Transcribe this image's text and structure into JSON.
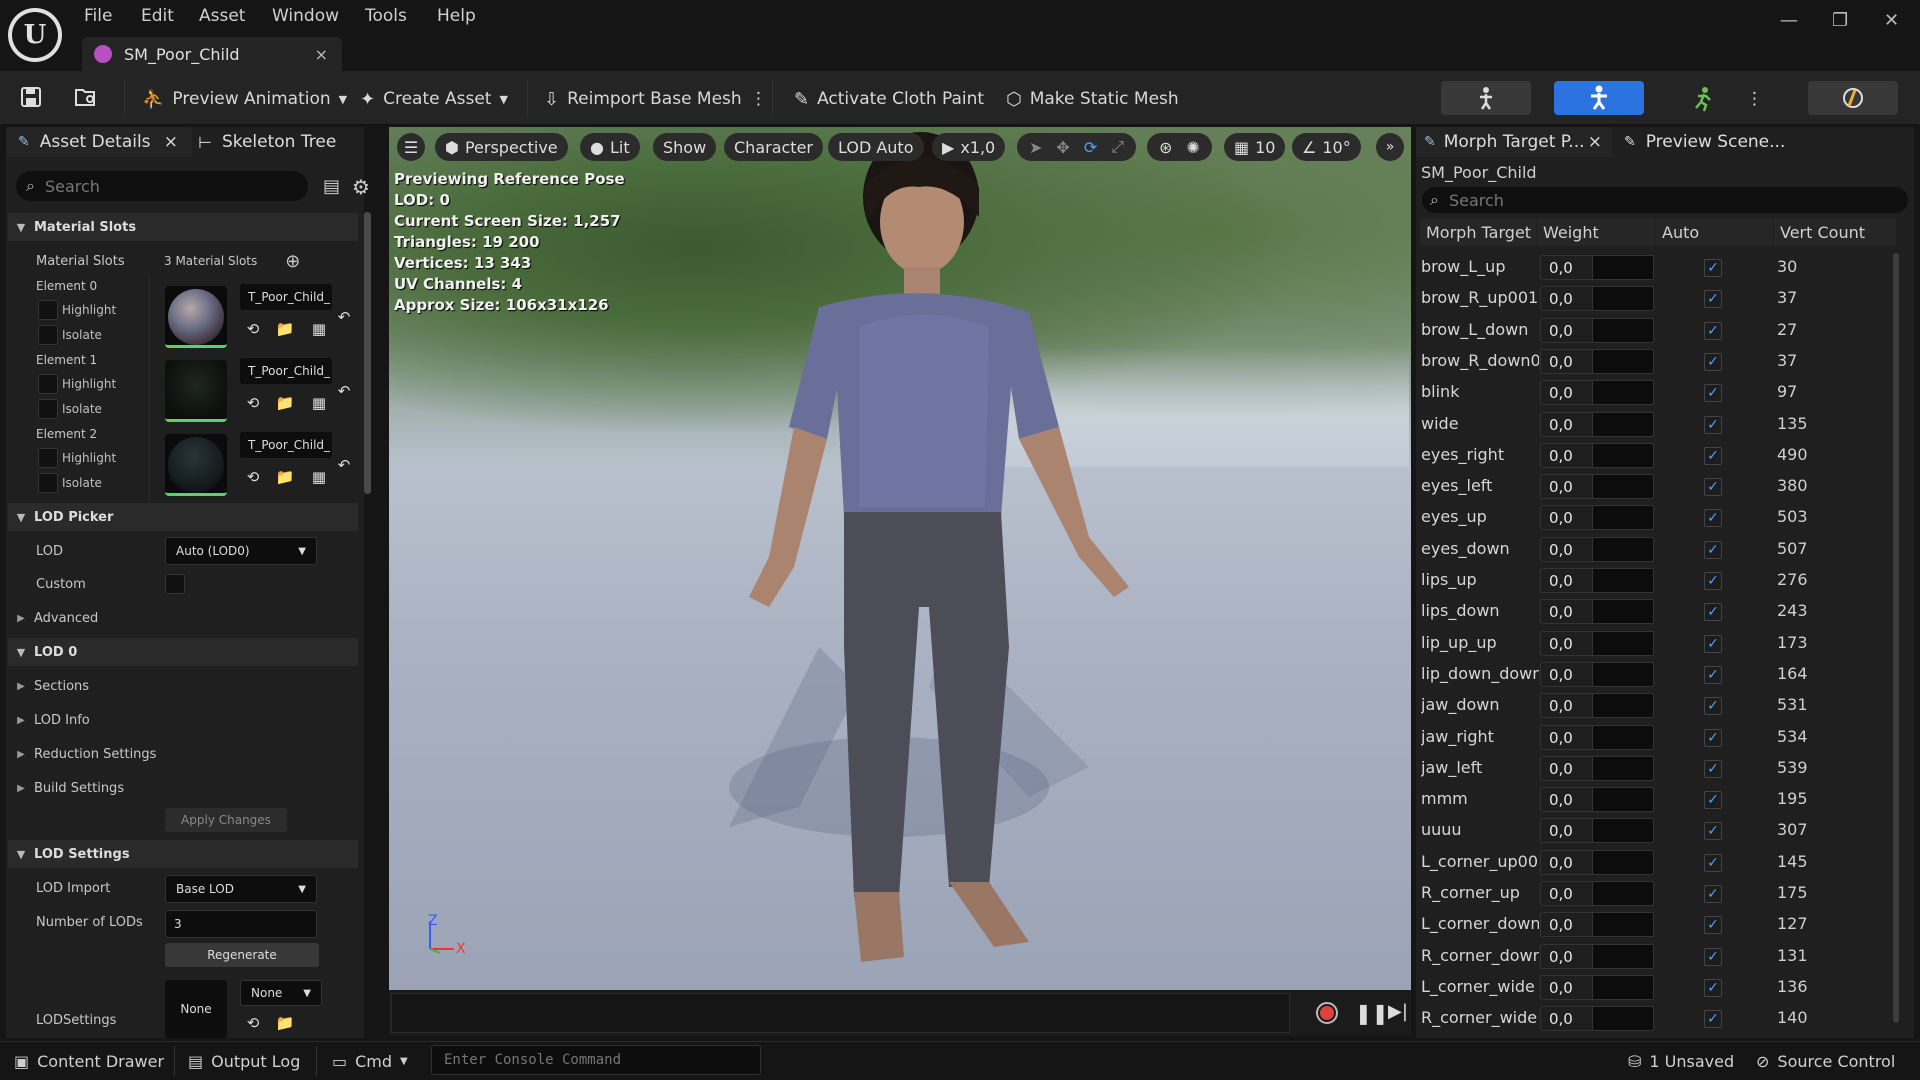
{
  "menu": [
    "File",
    "Edit",
    "Asset",
    "Window",
    "Tools",
    "Help"
  ],
  "doc_tab": {
    "title": "SM_Poor_Child",
    "close": "×"
  },
  "window_controls": {
    "minimize": "—",
    "restore": "❐",
    "close": "✕"
  },
  "toolbar": {
    "preview_animation": "Preview Animation",
    "create_asset": "Create Asset",
    "reimport": "Reimport Base Mesh",
    "activate_cloth_paint": "Activate Cloth Paint",
    "make_static_mesh": "Make Static Mesh"
  },
  "left_panel": {
    "tab_details": "Asset Details",
    "tab_close": "×",
    "tab_skeleton": "Skeleton Tree",
    "search_placeholder": "Search",
    "material_slots": {
      "header": "Material Slots",
      "label": "Material Slots",
      "value": "3 Material Slots",
      "elements": [
        {
          "name": "Element 0",
          "texture": "T_Poor_Child_",
          "highlight": "Highlight",
          "isolate": "Isolate"
        },
        {
          "name": "Element 1",
          "texture": "T_Poor_Child_",
          "highlight": "Highlight",
          "isolate": "Isolate"
        },
        {
          "name": "Element 2",
          "texture": "T_Poor_Child_",
          "highlight": "Highlight",
          "isolate": "Isolate"
        }
      ]
    },
    "lod_picker": {
      "header": "LOD Picker",
      "lod_label": "LOD",
      "lod_value": "Auto (LOD0)",
      "custom_label": "Custom",
      "advanced": "Advanced"
    },
    "lod0": {
      "header": "LOD 0",
      "sections": "Sections",
      "lod_info": "LOD Info",
      "reduction": "Reduction Settings",
      "build": "Build Settings",
      "apply": "Apply Changes"
    },
    "lod_settings": {
      "header": "LOD Settings",
      "import_label": "LOD Import",
      "import_value": "Base LOD",
      "num_label": "Number of LODs",
      "num_value": "3",
      "regenerate": "Regenerate",
      "settings_label": "LODSettings",
      "settings_thumb": "None",
      "settings_value": "None"
    }
  },
  "viewport": {
    "buttons": {
      "perspective": "Perspective",
      "lit": "Lit",
      "show": "Show",
      "character": "Character",
      "lod": "LOD Auto",
      "speed": "x1,0",
      "grid": "10",
      "angle": "10°"
    },
    "overlay": [
      "Previewing Reference Pose",
      "LOD: 0",
      "Current Screen Size: 1,257",
      "Triangles: 19 200",
      "Vertices: 13 343",
      "UV Channels: 4",
      "Approx Size: 106x31x126"
    ],
    "axis": {
      "z": "Z",
      "x": "X"
    }
  },
  "right_panel": {
    "tab_morph": "Morph Target P...",
    "tab_close": "×",
    "tab_scene": "Preview Scene...",
    "asset": "SM_Poor_Child",
    "search_placeholder": "Search",
    "columns": [
      "Morph Target",
      "Weight",
      "Auto",
      "Vert Count"
    ],
    "rows": [
      {
        "name": "brow_L_up",
        "weight": "0,0",
        "auto": "✓",
        "verts": "30"
      },
      {
        "name": "brow_R_up001",
        "weight": "0,0",
        "auto": "✓",
        "verts": "37"
      },
      {
        "name": "brow_L_down",
        "weight": "0,0",
        "auto": "✓",
        "verts": "27"
      },
      {
        "name": "brow_R_down0",
        "weight": "0,0",
        "auto": "✓",
        "verts": "37"
      },
      {
        "name": "blink",
        "weight": "0,0",
        "auto": "✓",
        "verts": "97"
      },
      {
        "name": "wide",
        "weight": "0,0",
        "auto": "✓",
        "verts": "135"
      },
      {
        "name": "eyes_right",
        "weight": "0,0",
        "auto": "✓",
        "verts": "490"
      },
      {
        "name": "eyes_left",
        "weight": "0,0",
        "auto": "✓",
        "verts": "380"
      },
      {
        "name": "eyes_up",
        "weight": "0,0",
        "auto": "✓",
        "verts": "503"
      },
      {
        "name": "eyes_down",
        "weight": "0,0",
        "auto": "✓",
        "verts": "507"
      },
      {
        "name": "lips_up",
        "weight": "0,0",
        "auto": "✓",
        "verts": "276"
      },
      {
        "name": "lips_down",
        "weight": "0,0",
        "auto": "✓",
        "verts": "243"
      },
      {
        "name": "lip_up_up",
        "weight": "0,0",
        "auto": "✓",
        "verts": "173"
      },
      {
        "name": "lip_down_down",
        "weight": "0,0",
        "auto": "✓",
        "verts": "164"
      },
      {
        "name": "jaw_down",
        "weight": "0,0",
        "auto": "✓",
        "verts": "531"
      },
      {
        "name": "jaw_right",
        "weight": "0,0",
        "auto": "✓",
        "verts": "534"
      },
      {
        "name": "jaw_left",
        "weight": "0,0",
        "auto": "✓",
        "verts": "539"
      },
      {
        "name": "mmm",
        "weight": "0,0",
        "auto": "✓",
        "verts": "195"
      },
      {
        "name": "uuuu",
        "weight": "0,0",
        "auto": "✓",
        "verts": "307"
      },
      {
        "name": "L_corner_up00",
        "weight": "0,0",
        "auto": "✓",
        "verts": "145"
      },
      {
        "name": "R_corner_up",
        "weight": "0,0",
        "auto": "✓",
        "verts": "175"
      },
      {
        "name": "L_corner_down",
        "weight": "0,0",
        "auto": "✓",
        "verts": "127"
      },
      {
        "name": "R_corner_down",
        "weight": "0,0",
        "auto": "✓",
        "verts": "131"
      },
      {
        "name": "L_corner_wide",
        "weight": "0,0",
        "auto": "✓",
        "verts": "136"
      },
      {
        "name": "R_corner_wide",
        "weight": "0,0",
        "auto": "✓",
        "verts": "140"
      }
    ]
  },
  "status_bar": {
    "content_drawer": "Content Drawer",
    "output_log": "Output Log",
    "cmd": "Cmd",
    "console_placeholder": "Enter Console Command",
    "unsaved": "1 Unsaved",
    "source_control": "Source Control"
  },
  "colors": {
    "accent": "#2b74e0",
    "checkbox": "#4aa3ff",
    "record": "#e04040",
    "material_bar": "#59d46c"
  }
}
